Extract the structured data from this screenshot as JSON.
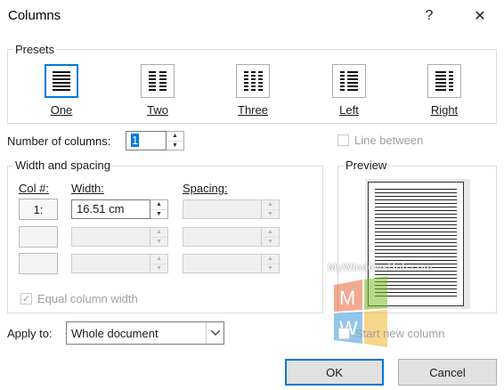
{
  "window": {
    "title": "Columns",
    "help_glyph": "?",
    "close_glyph": "✕"
  },
  "presets": {
    "group_label": "Presets",
    "items": [
      {
        "label": "One",
        "icon": "one-column-icon",
        "selected": true
      },
      {
        "label": "Two",
        "icon": "two-columns-icon",
        "selected": false
      },
      {
        "label": "Three",
        "icon": "three-columns-icon",
        "selected": false
      },
      {
        "label": "Left",
        "icon": "left-columns-icon",
        "selected": false
      },
      {
        "label": "Right",
        "icon": "right-columns-icon",
        "selected": false
      }
    ]
  },
  "number_of_columns": {
    "label": "Number of columns:",
    "value": "1"
  },
  "line_between": {
    "label": "Line between",
    "checked": false,
    "enabled": false
  },
  "width_spacing": {
    "group_label": "Width and spacing",
    "col_header": "Col #:",
    "width_header": "Width:",
    "spacing_header": "Spacing:",
    "rows": [
      {
        "col": "1:",
        "width": "16.51 cm",
        "spacing": ""
      },
      {
        "col": "",
        "width": "",
        "spacing": ""
      },
      {
        "col": "",
        "width": "",
        "spacing": ""
      }
    ],
    "equal_width": {
      "label": "Equal column width",
      "checked": true,
      "enabled": false
    }
  },
  "preview": {
    "group_label": "Preview"
  },
  "apply_to": {
    "label": "Apply to:",
    "value": "Whole document"
  },
  "start_new_column": {
    "label": "Start new column",
    "checked": false,
    "enabled": false
  },
  "buttons": {
    "ok": "OK",
    "cancel": "Cancel"
  },
  "watermark": {
    "text": "MyWindowsHub.com"
  },
  "colors": {
    "accent": "#0078d7",
    "disabled_text": "#a0a0a0"
  }
}
